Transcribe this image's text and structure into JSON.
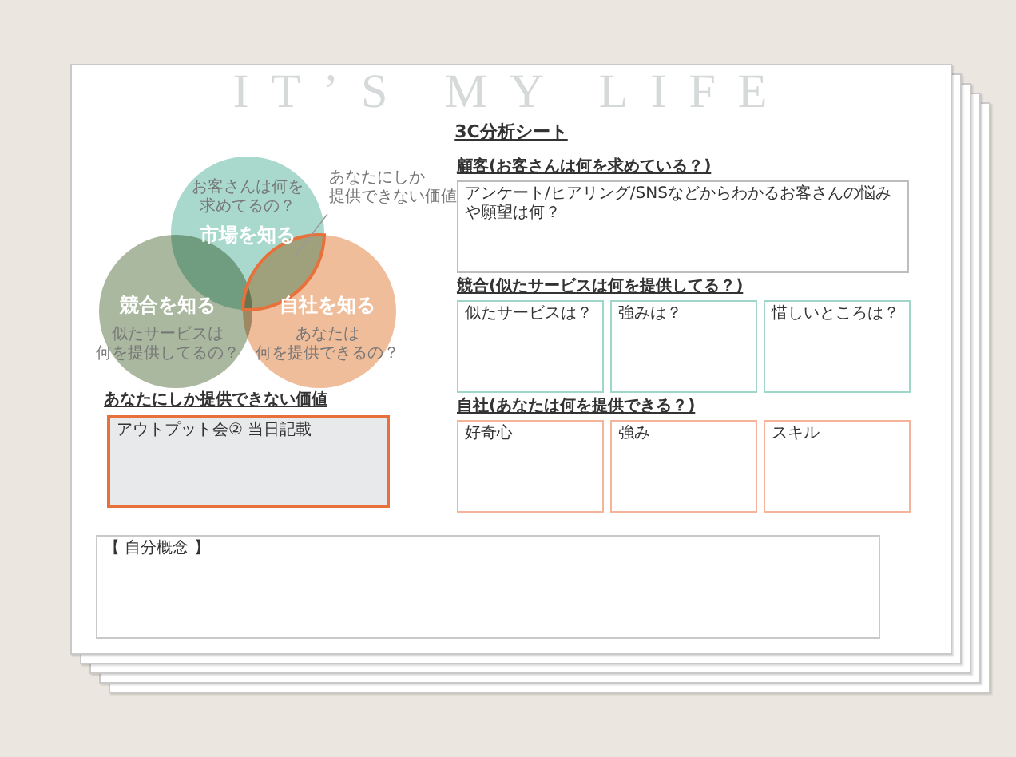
{
  "watermark": "IT’S MY LIFE",
  "title": "3C分析シート",
  "venn": {
    "circles": [
      {
        "title": "市場を知る",
        "caption_lines": [
          "お客さんは何を",
          "求めてるの？"
        ],
        "color": "#a9d9cd"
      },
      {
        "title": "競合を知る",
        "caption_lines": [
          "似たサービスは",
          "何を提供してるの？"
        ],
        "color": "#a9b89f"
      },
      {
        "title": "自社を知る",
        "caption_lines": [
          "あなたは",
          "何を提供できるの？"
        ],
        "color": "#f0bd9b"
      }
    ],
    "overlap_label_lines": [
      "あなたにしか",
      "提供できない価値"
    ]
  },
  "unique_value": {
    "heading": "あなたにしか提供できない価値",
    "box_label": "アウトプット会② 当日記載"
  },
  "customer": {
    "heading": "顧客(お客さんは何を求めている？)",
    "box_label": "アンケート/ヒアリング/SNSなどからわかるお客さんの悩みや願望は何？"
  },
  "competitor": {
    "heading": "競合(似たサービスは何を提供してる？)",
    "boxes": [
      "似たサービスは？",
      "強みは？",
      "惜しいところは？"
    ]
  },
  "company": {
    "heading": "自社(あなたは何を提供できる？)",
    "boxes": [
      "好奇心",
      "強み",
      "スキル"
    ]
  },
  "self_concept": {
    "label": "【 自分概念 】"
  }
}
